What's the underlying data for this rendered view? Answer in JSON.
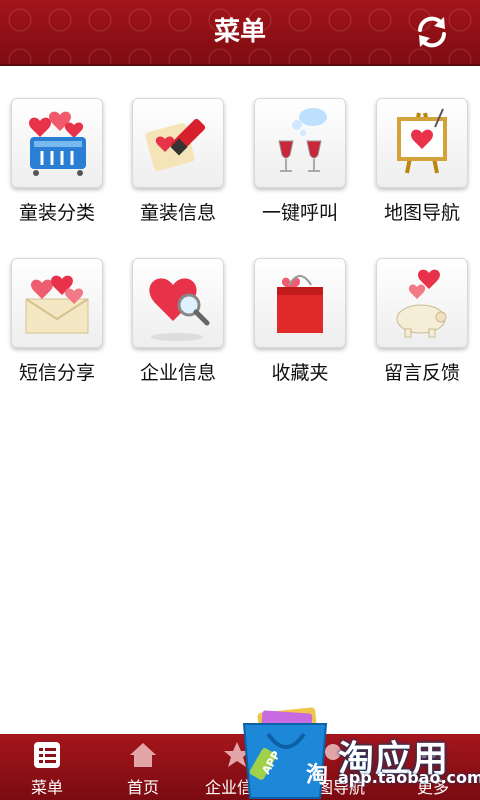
{
  "header": {
    "title": "菜单",
    "refresh_icon": "refresh-icon"
  },
  "menu": {
    "items": [
      {
        "label": "童装分类",
        "icon": "basket-hearts-icon"
      },
      {
        "label": "童装信息",
        "icon": "note-marker-icon"
      },
      {
        "label": "一键呼叫",
        "icon": "wine-glasses-icon"
      },
      {
        "label": "地图导航",
        "icon": "easel-heart-icon"
      },
      {
        "label": "短信分享",
        "icon": "envelope-hearts-icon"
      },
      {
        "label": "企业信息",
        "icon": "heart-magnifier-icon"
      },
      {
        "label": "收藏夹",
        "icon": "shopping-bag-icon"
      },
      {
        "label": "留言反馈",
        "icon": "piggy-bank-hearts-icon"
      }
    ]
  },
  "tabbar": {
    "tabs": [
      {
        "label": "菜单",
        "icon": "list-icon",
        "active": true
      },
      {
        "label": "首页",
        "icon": "home-icon"
      },
      {
        "label": "企业信息",
        "icon": "star-icon"
      },
      {
        "label": "地图导航",
        "icon": "map-icon"
      },
      {
        "label": "更多",
        "icon": "more-icon"
      }
    ]
  },
  "promo": {
    "brand": "淘应用",
    "url": "app.taobao.com",
    "badge": "APP",
    "bag_char": "淘"
  },
  "colors": {
    "header_red": "#8e1016",
    "tab_red": "#8e1016",
    "promo_blue": "#1e88d8"
  }
}
